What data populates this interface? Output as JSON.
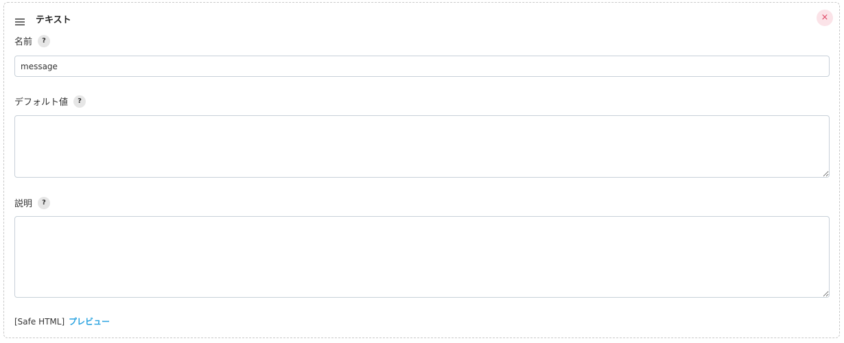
{
  "header": {
    "title": "テキスト",
    "drag_icon": "hamburger-menu-icon",
    "close_icon": "close-icon",
    "close_glyph": "×"
  },
  "fields": {
    "name": {
      "label": "名前",
      "help": "?",
      "value": "message"
    },
    "default_value": {
      "label": "デフォルト値",
      "help": "?",
      "value": ""
    },
    "description": {
      "label": "説明",
      "help": "?",
      "value": ""
    }
  },
  "footer": {
    "format_label": "[Safe HTML]",
    "preview_link": "プレビュー"
  },
  "colors": {
    "close_bg": "#fbe3e8",
    "close_fg": "#e04a68",
    "link": "#2aa3e0",
    "input_border": "#c7d0d8"
  }
}
